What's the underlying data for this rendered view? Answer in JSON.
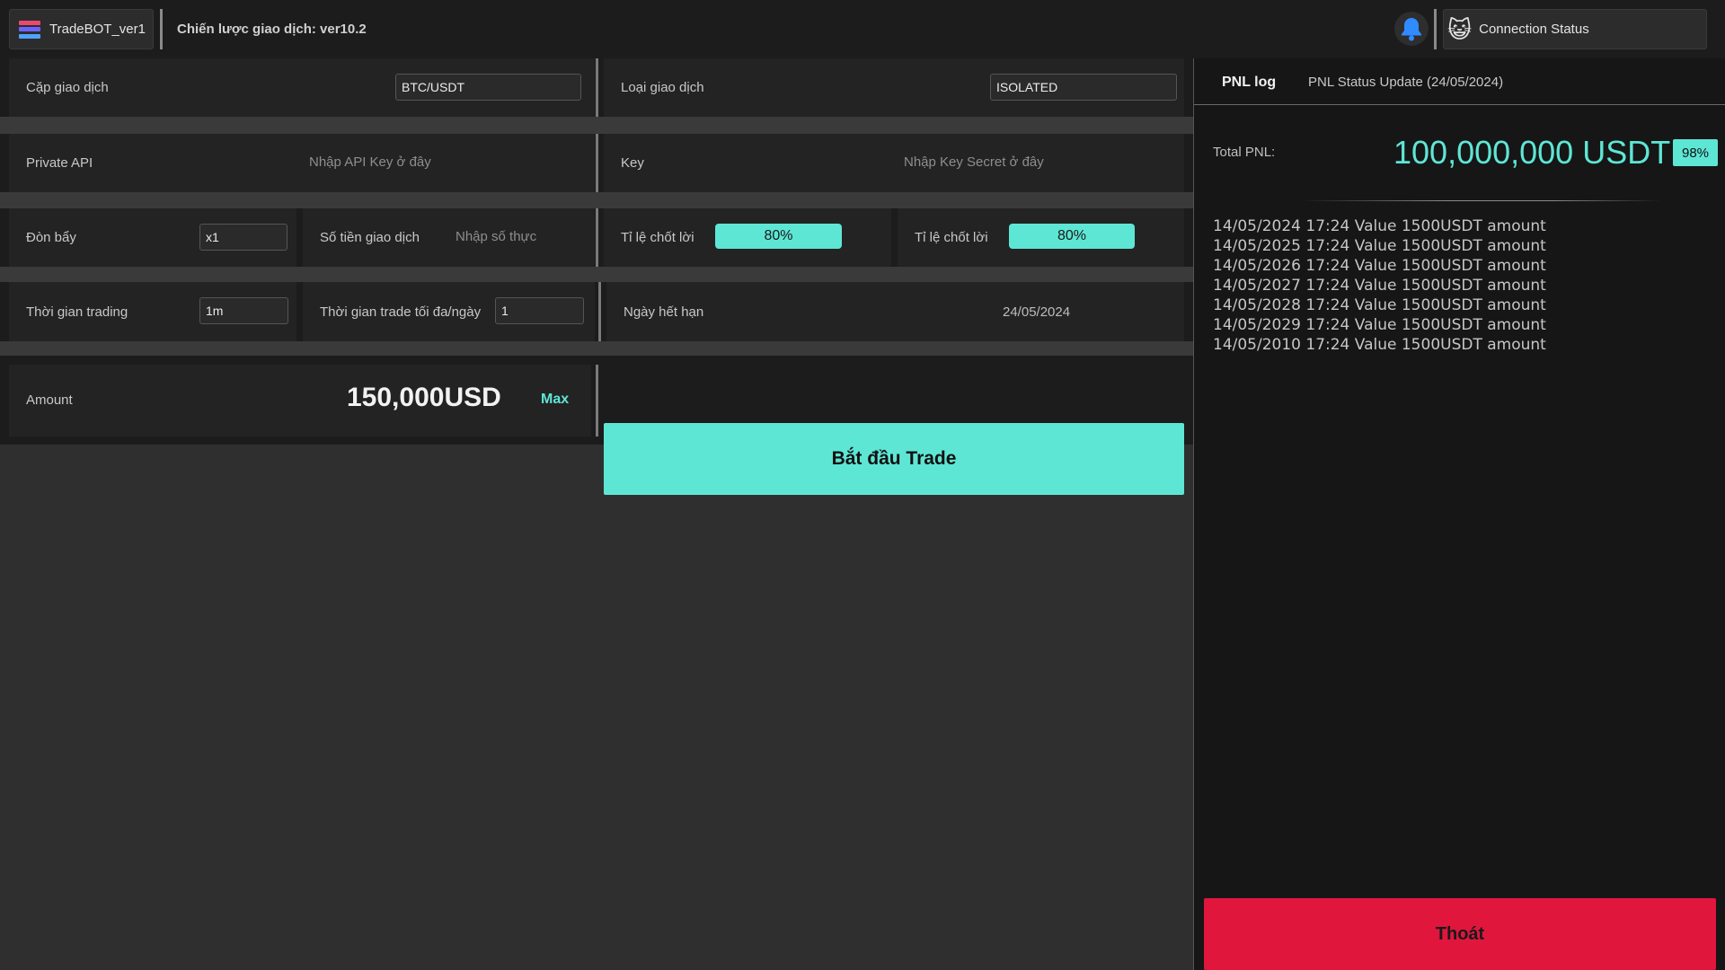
{
  "header": {
    "app_name": "TradeBOT_ver1",
    "strategy": "Chiến lược giao dịch: ver10.2",
    "connection_status": "Connection Status"
  },
  "form": {
    "pair_label": "Cặp giao dịch",
    "pair_value": "BTC/USDT",
    "trade_type_label": "Loại giao dịch",
    "trade_type_value": "ISOLATED",
    "private_api_label": "Private API",
    "private_api_placeholder": "Nhập API Key ở đây",
    "key_label": "Key",
    "key_placeholder": "Nhập Key Secret ở đây",
    "leverage_label": "Đòn bẩy",
    "leverage_value": "x1",
    "trade_amount_label": "Số tiền giao dịch",
    "trade_amount_placeholder": "Nhập số thực",
    "take_profit_label_1": "Tỉ lệ chốt lời",
    "take_profit_value_1": "80%",
    "take_profit_label_2": "Tỉ lệ chốt lời",
    "take_profit_value_2": "80%",
    "trading_time_label": "Thời gian trading",
    "trading_time_value": "1m",
    "max_trade_time_label": "Thời gian trade tối đa/ngày",
    "max_trade_time_value": "1",
    "expiry_label": "Ngày hết hạn",
    "expiry_value": "24/05/2024",
    "amount_label": "Amount",
    "amount_value": "150,000USD",
    "max_label": "Max",
    "start_button": "Bắt đầu Trade"
  },
  "pnl": {
    "tab_active": "PNL log",
    "tab_other": "PNL Status Update (24/05/2024)",
    "total_label": "Total PNL:",
    "total_value": "100,000,000 USDT",
    "percent": "98%",
    "log": [
      "14/05/2024 17:24 Value 1500USDT amount",
      "14/05/2025 17:24 Value 1500USDT amount",
      "14/05/2026 17:24 Value 1500USDT amount",
      "14/05/2027 17:24 Value 1500USDT amount",
      "14/05/2028 17:24 Value 1500USDT amount",
      "14/05/2029 17:24 Value 1500USDT amount",
      "14/05/2010 17:24 Value 1500USDT amount"
    ],
    "exit_button": "Thoát"
  },
  "colors": {
    "accent": "#5ee6d5",
    "danger": "#e0163d",
    "background": "#2f2f2f",
    "panel": "#1c1c1c"
  },
  "icons": [
    "app-logo-icon",
    "bell-icon",
    "cat-avatar-icon"
  ]
}
